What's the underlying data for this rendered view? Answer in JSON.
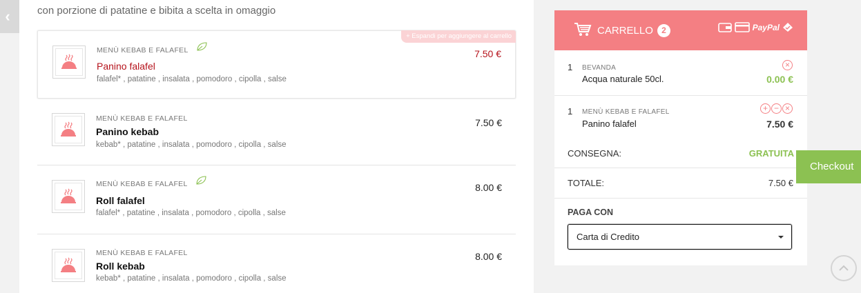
{
  "intro": "con porzione di patatine e bibita a scelta in omaggio",
  "expand_hint": "+ Espandi per aggiungere al carrello",
  "menu_items": [
    {
      "category": "MENÙ KEBAB E FALAFEL",
      "name": "Panino falafel",
      "ingredients": "falafel* , patatine , insalata , pomodoro , cipolla , salse",
      "price": "7.50 €",
      "vegetarian": true
    },
    {
      "category": "MENÙ KEBAB E FALAFEL",
      "name": "Panino kebab",
      "ingredients": "kebab* , patatine , insalata , pomodoro , cipolla , salse",
      "price": "7.50 €",
      "vegetarian": false
    },
    {
      "category": "MENÙ KEBAB E FALAFEL",
      "name": "Roll falafel",
      "ingredients": "falafel* , patatine , insalata , pomodoro , cipolla , salse",
      "price": "8.00 €",
      "vegetarian": true
    },
    {
      "category": "MENÙ KEBAB E FALAFEL",
      "name": "Roll kebab",
      "ingredients": "kebab* , patatine , insalata , pomodoro , cipolla , salse",
      "price": "8.00 €",
      "vegetarian": false
    }
  ],
  "cart": {
    "title": "CARRELLO",
    "count": "2",
    "paypal_label": "PayPal",
    "lines": [
      {
        "qty": "1",
        "category": "BEVANDA",
        "name": "Acqua naturale 50cl.",
        "price": "0.00 €"
      },
      {
        "qty": "1",
        "category": "MENÙ KEBAB E FALAFEL",
        "name": "Panino falafel",
        "price": "7.50 €"
      }
    ],
    "delivery_label": "CONSEGNA:",
    "delivery_value": "GRATUITA",
    "total_label": "TOTALE:",
    "total_value": "7.50 €",
    "pay_with_label": "PAGA CON",
    "payment_method": "Carta di Credito"
  },
  "checkout_label": "Checkout",
  "colors": {
    "accent": "#f47f83",
    "price_red": "#b5121b",
    "green": "#8cc152"
  }
}
